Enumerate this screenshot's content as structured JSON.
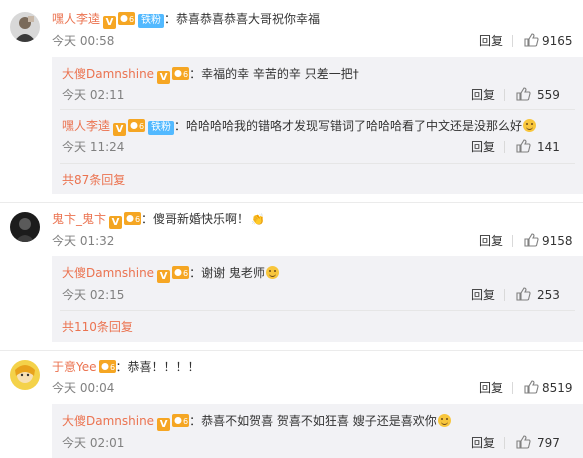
{
  "icons": {
    "vip": "V",
    "like": "thumb-up-icon"
  },
  "colors": {
    "username": "#eb7350",
    "fan_badge": "#52b9ff",
    "reply_bg": "#f2f2f5",
    "meta": "#808080"
  },
  "comments": [
    {
      "user": "嘿人李逵",
      "fan_badge": "铁粉",
      "text": "：恭喜恭喜恭喜大哥祝你幸福",
      "time": "今天 00:58",
      "reply_label": "回复",
      "likes": "9165",
      "replies": [
        {
          "user": "大傻Damnshine",
          "text": "：幸福的幸 辛苦的辛 只差一把†",
          "time": "今天 02:11",
          "reply_label": "回复",
          "likes": "559"
        },
        {
          "user": "嘿人李逵",
          "fan_badge": "铁粉",
          "text": "：哈哈哈哈我的错咯才发现写错词了哈哈哈看了中文还是没那么好",
          "time": "今天 11:24",
          "reply_label": "回复",
          "likes": "141"
        }
      ],
      "more": "共87条回复"
    },
    {
      "user": "鬼卞_鬼卞",
      "text": "：傻哥新婚快乐啊！",
      "time": "今天 01:32",
      "reply_label": "回复",
      "likes": "9158",
      "replies": [
        {
          "user": "大傻Damnshine",
          "text": "：谢谢 鬼老师",
          "time": "今天 02:15",
          "reply_label": "回复",
          "likes": "253"
        }
      ],
      "more": "共110条回复"
    },
    {
      "user": "于意Yee",
      "text": "：恭喜！！！！",
      "time": "今天 00:04",
      "reply_label": "回复",
      "likes": "8519",
      "replies": [
        {
          "user": "大傻Damnshine",
          "text": "：恭喜不如贺喜 贺喜不如狂喜  嫂子还是喜欢你",
          "time": "今天 02:01",
          "reply_label": "回复",
          "likes": "797"
        }
      ]
    }
  ]
}
